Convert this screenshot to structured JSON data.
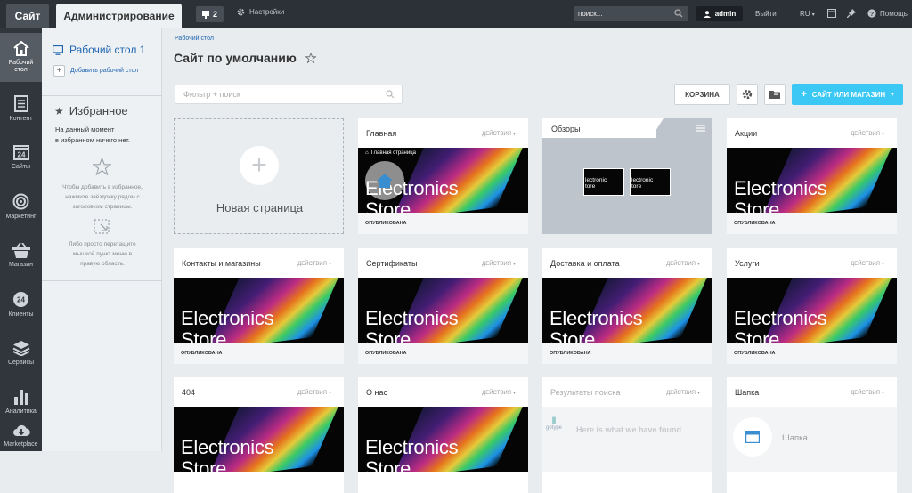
{
  "topbar": {
    "tab_site": "Сайт",
    "tab_admin": "Администрирование",
    "notifications_count": "2",
    "settings_label": "Настройки",
    "search_placeholder": "поиск...",
    "user_name": "admin",
    "logout_label": "Выйти",
    "language": "RU",
    "help_label": "Помощь"
  },
  "nav": {
    "items": [
      {
        "label_line1": "Рабочий",
        "label_line2": "стол",
        "icon": "home-icon"
      },
      {
        "label_line1": "Контент",
        "label_line2": "",
        "icon": "document-icon"
      },
      {
        "label_line1": "Сайты",
        "label_line2": "",
        "icon": "calendar-24-icon"
      },
      {
        "label_line1": "Маркетинг",
        "label_line2": "",
        "icon": "target-icon"
      },
      {
        "label_line1": "Магазин",
        "label_line2": "",
        "icon": "basket-icon"
      },
      {
        "label_line1": "Клиенты",
        "label_line2": "",
        "icon": "clock-24-icon"
      },
      {
        "label_line1": "Сервисы",
        "label_line2": "",
        "icon": "layers-icon"
      },
      {
        "label_line1": "Аналитика",
        "label_line2": "",
        "icon": "bar-chart-icon"
      },
      {
        "label_line1": "Marketplace",
        "label_line2": "",
        "icon": "cloud-download-icon"
      }
    ]
  },
  "panel": {
    "desktop_title": "Рабочий стол 1",
    "add_desktop": "Добавить рабочий стол",
    "favorites_title": "Избранное",
    "favorites_empty_1": "На данный момент",
    "favorites_empty_2": "в избранном ничего нет.",
    "hint1_1": "Чтобы добавить в избранное,",
    "hint1_2": "нажмите звёздочку рядом с",
    "hint1_3": "заголовком страницы.",
    "hint2_1": "Либо просто перетащите",
    "hint2_2": "мышкой пункт меню в",
    "hint2_3": "правую область."
  },
  "main": {
    "breadcrumb": "Рабочий стол",
    "page_title": "Сайт по умолчанию",
    "filter_placeholder": "Фильтр + поиск",
    "btn_trash": "КОРЗИНА",
    "btn_add": "САЙТ ИЛИ МАГАЗИН",
    "new_page_label": "Новая страница",
    "actions_label": "ДЕЙСТВИЯ",
    "published_label": "ОПУБЛИКОВАНА",
    "brand_line1": "Electronics",
    "brand_line2": "Store",
    "home_strip_label": "Главная страница",
    "folder_name": "Обзоры",
    "folder_thumb_1": "lectronic",
    "folder_thumb_2": "tore",
    "cards": [
      {
        "title": "Главная"
      },
      {
        "title": "Акции"
      },
      {
        "title": "Контакты и магазины"
      },
      {
        "title": "Сертификаты"
      },
      {
        "title": "Доставка и оплата"
      },
      {
        "title": "Услуги"
      },
      {
        "title": "404"
      },
      {
        "title": "О нас"
      },
      {
        "title": "Результаты поиска"
      },
      {
        "title": "Шапка"
      }
    ],
    "search_results_logo": "gotype",
    "search_results_text": "Here is what we have found",
    "header_card_text": "Шапка"
  },
  "colors": {
    "topbar_bg": "#2c3138",
    "nav_bg": "#30363c",
    "accent_blue": "#3bc8f5",
    "link_blue": "#2066b0"
  }
}
